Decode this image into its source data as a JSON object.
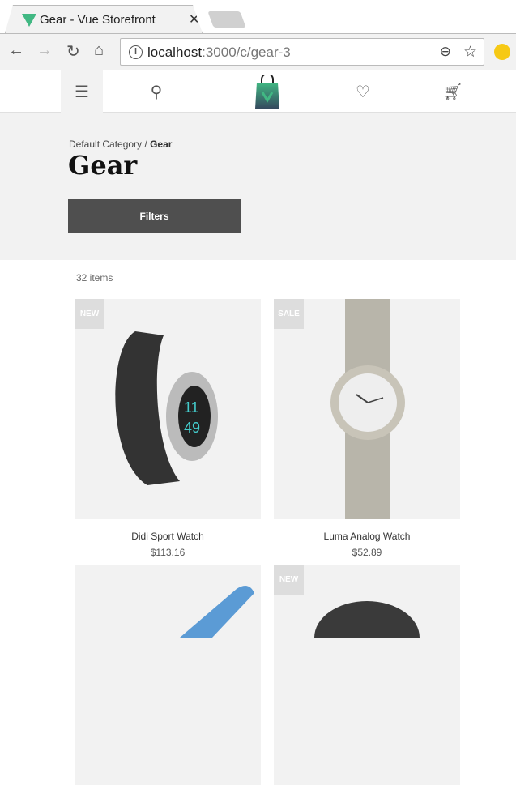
{
  "browser": {
    "tab_title": "Gear - Vue Storefront",
    "url_host": "localhost",
    "url_rest": ":3000/c/gear-3"
  },
  "header": {
    "icons": [
      "menu-icon",
      "search-icon",
      "logo",
      "heart-icon",
      "cart-icon"
    ]
  },
  "hero": {
    "breadcrumb_parent": "Default Category",
    "breadcrumb_sep": " / ",
    "breadcrumb_current": "Gear",
    "title": "Gear",
    "filters_label": "Filters"
  },
  "listing": {
    "count": "32 items",
    "products": [
      {
        "badge": "NEW",
        "name": "Didi Sport Watch",
        "price": "$113.16"
      },
      {
        "badge": "SALE",
        "name": "Luma Analog Watch",
        "price": "$52.89"
      },
      {
        "badge": "",
        "name": "",
        "price": ""
      },
      {
        "badge": "NEW",
        "name": "",
        "price": ""
      }
    ]
  },
  "colors": {
    "accent": "#41b883",
    "button": "#4f4f4f",
    "hero_bg": "#f2f2f2"
  }
}
